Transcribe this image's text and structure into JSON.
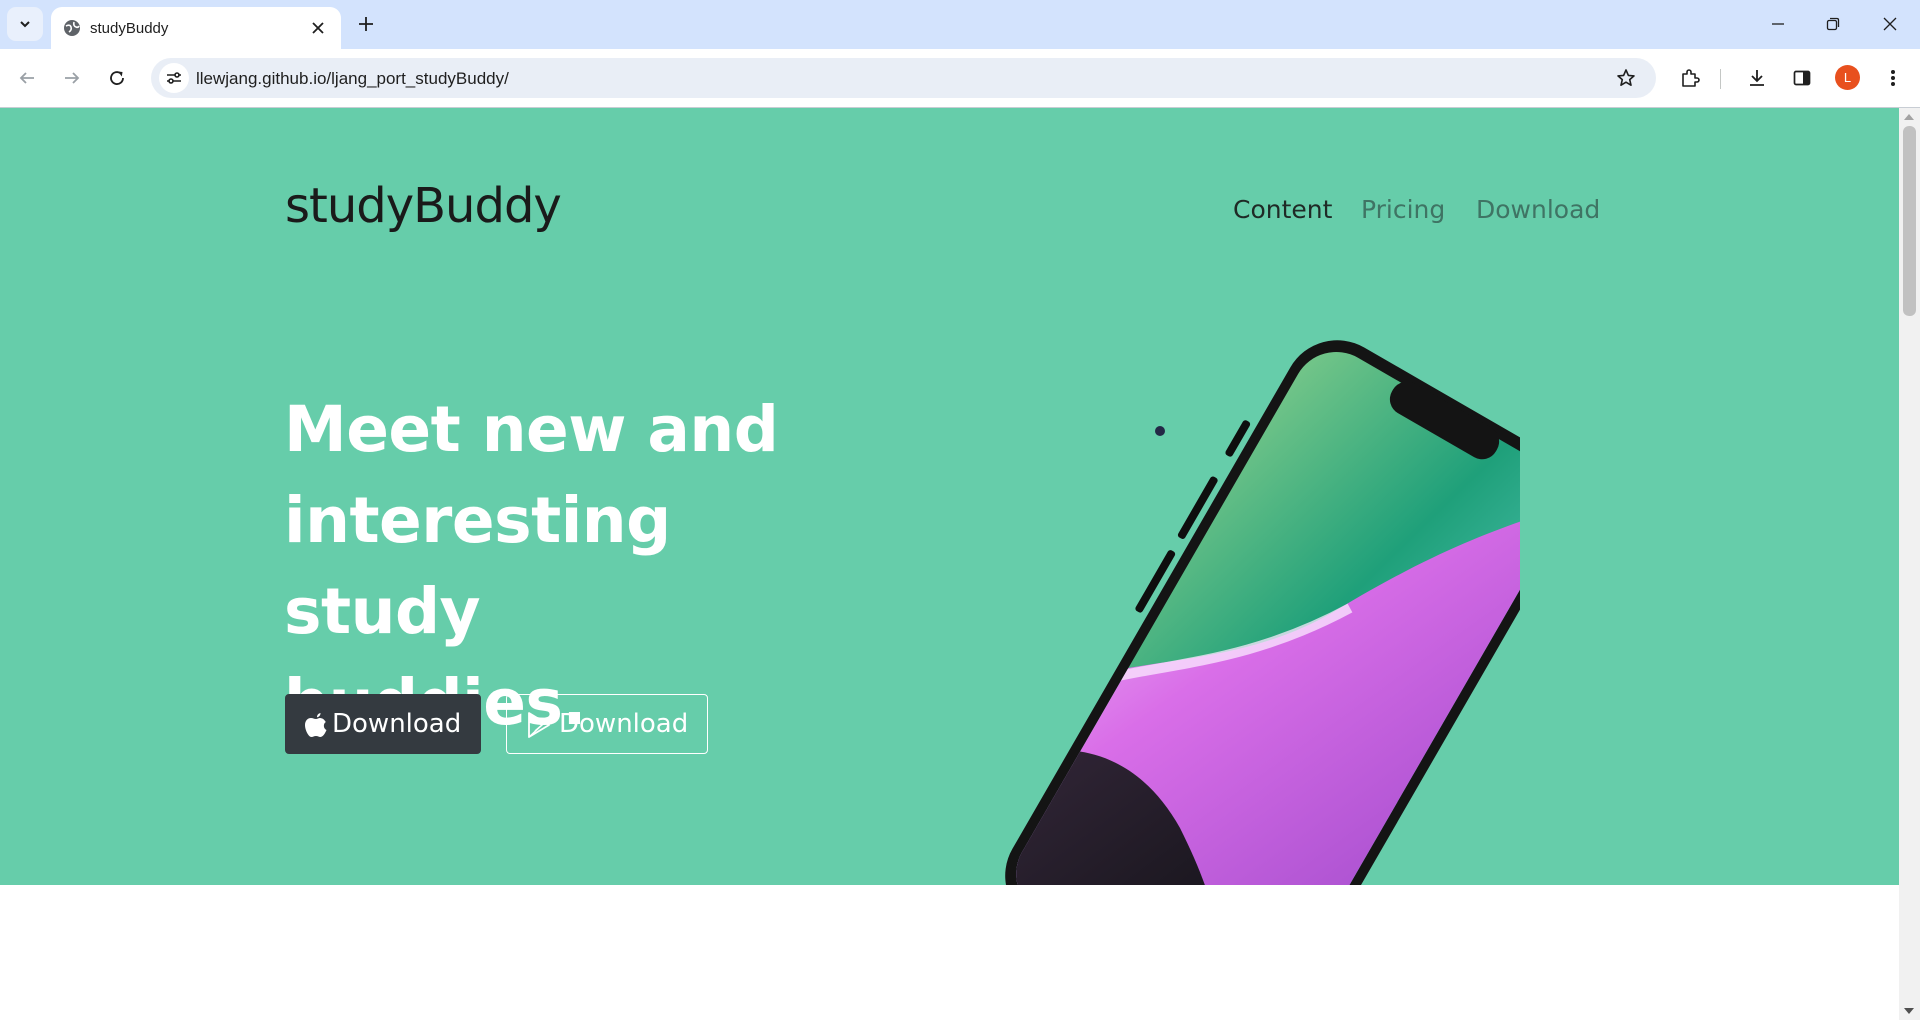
{
  "browser": {
    "tab": {
      "title": "studyBuddy",
      "favicon": "globe-icon"
    },
    "url": "llewjang.github.io/ljang_port_studyBuddy/",
    "profile_initial": "L",
    "profile_color": "#e8501e"
  },
  "page": {
    "brand": "studyBuddy",
    "nav": [
      {
        "label": "Content",
        "active": true
      },
      {
        "label": "Pricing",
        "active": false
      },
      {
        "label": "Download",
        "active": false
      }
    ],
    "hero": {
      "headline_lines": [
        "Meet new and",
        "interesting study",
        "buddies."
      ],
      "buttons": [
        {
          "label": "Download",
          "icon": "apple-icon",
          "style": "dark"
        },
        {
          "label": "Download",
          "icon": "google-play-icon",
          "style": "outline"
        }
      ],
      "background_color": "#66cdaa"
    }
  }
}
